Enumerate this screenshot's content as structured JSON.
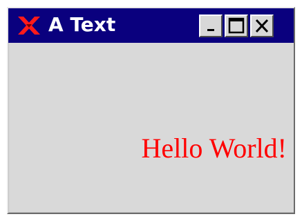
{
  "window": {
    "title": "A Text",
    "icon": "x-logo-icon",
    "buttons": [
      "minimize",
      "maximize",
      "close"
    ]
  },
  "content": {
    "label_text": "Hello World!",
    "label_color": "#ff0000"
  },
  "colors": {
    "titlebar": "#0a007e",
    "client_bg": "#d9d9d9"
  }
}
